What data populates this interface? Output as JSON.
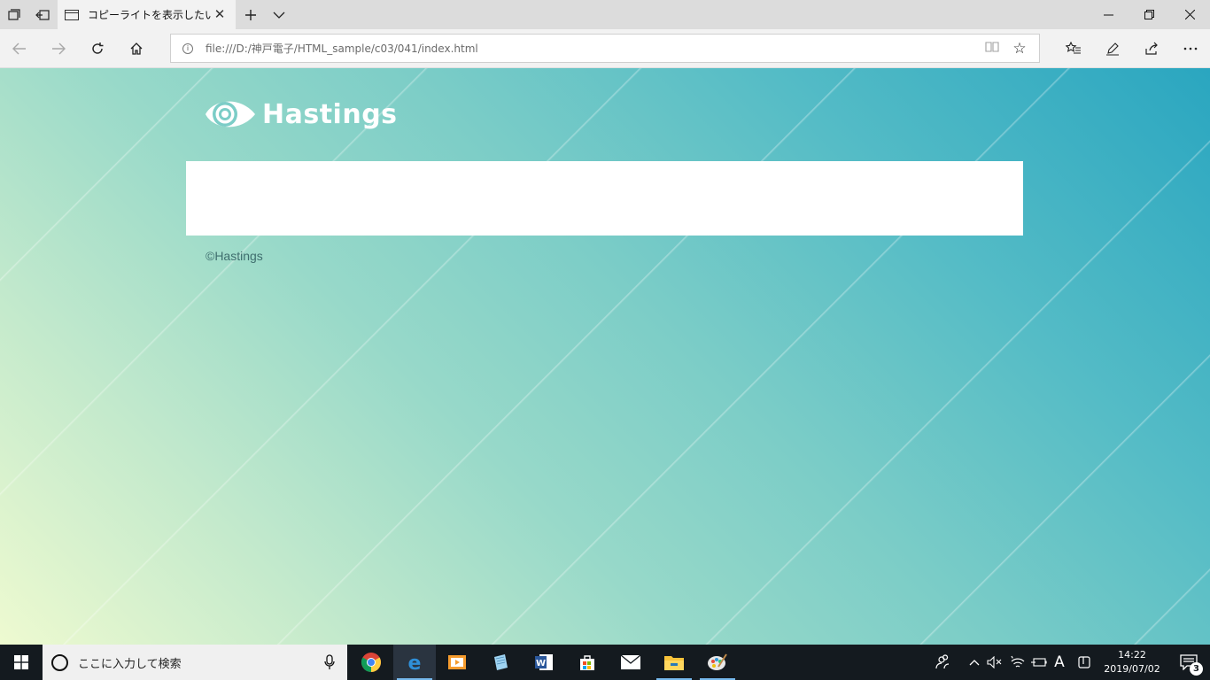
{
  "browser": {
    "tab": {
      "title": "コピーライトを表示したい",
      "icon": "page-icon"
    },
    "new_tab_icon": "plus-icon",
    "tab_list_icon": "chevron-down-icon",
    "address": {
      "url": "file:///D:/神戸電子/HTML_sample/c03/041/index.html"
    }
  },
  "page": {
    "logo_text": "Hastings",
    "copyright": "©Hastings"
  },
  "taskbar": {
    "search_placeholder": "ここに入力して検索",
    "clock_time": "14:22",
    "clock_date": "2019/07/02",
    "ime_indicator": "A",
    "notification_count": "3",
    "apps": [
      "chrome",
      "edge",
      "media-player",
      "notepad",
      "word",
      "store",
      "mail",
      "file-explorer",
      "paint"
    ]
  }
}
